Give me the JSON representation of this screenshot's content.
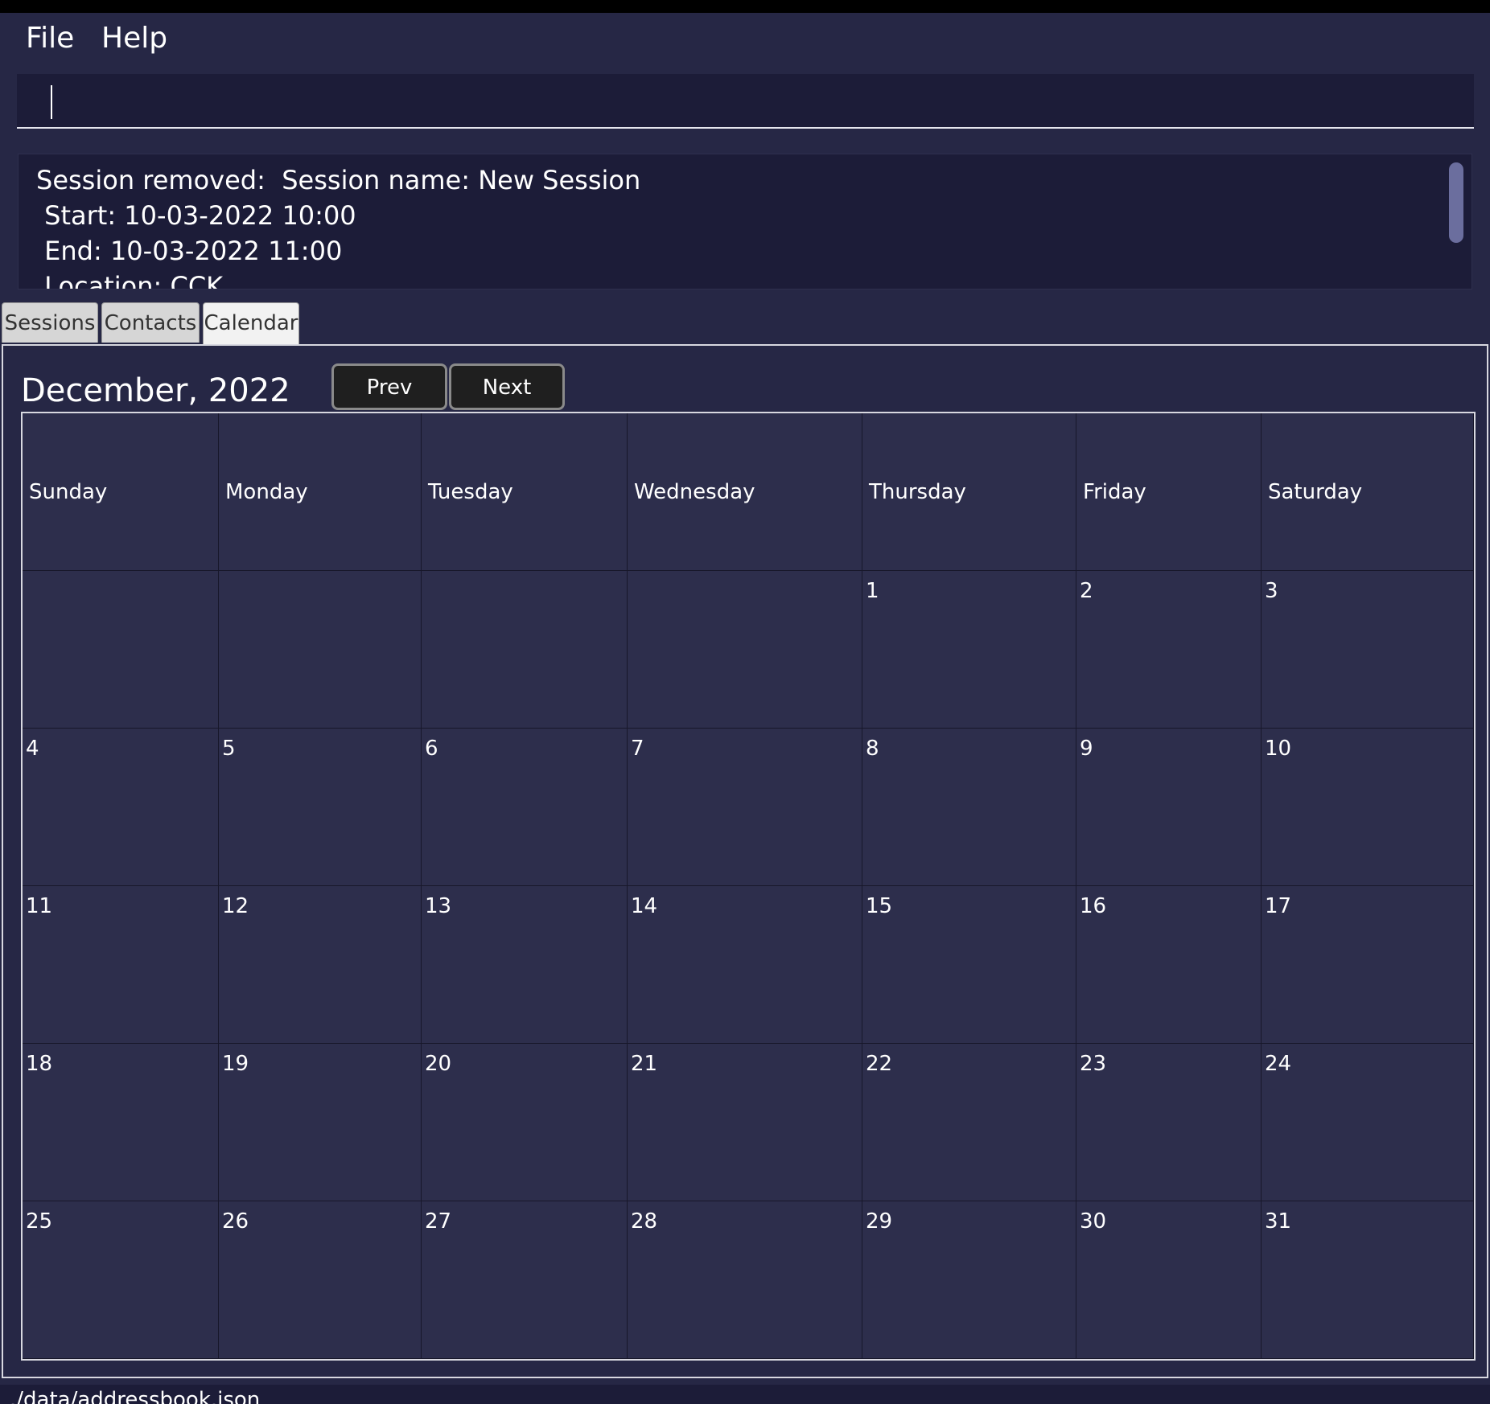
{
  "menu": {
    "file": "File",
    "help": "Help"
  },
  "command": {
    "value": "",
    "placeholder": ""
  },
  "result": {
    "text": "Session removed:  Session name: New Session\n Start: 10-03-2022 10:00\n End: 10-03-2022 11:00\n Location: CCK"
  },
  "tabs": [
    {
      "label": "Sessions"
    },
    {
      "label": "Contacts"
    },
    {
      "label": "Calendar"
    }
  ],
  "calendar": {
    "month_title": "December, 2022",
    "prev_label": "Prev",
    "next_label": "Next",
    "weekdays": [
      "Sunday",
      "Monday",
      "Tuesday",
      "Wednesday",
      "Thursday",
      "Friday",
      "Saturday"
    ],
    "weeks": [
      [
        "",
        "",
        "",
        "",
        "1",
        "2",
        "3"
      ],
      [
        "4",
        "5",
        "6",
        "7",
        "8",
        "9",
        "10"
      ],
      [
        "11",
        "12",
        "13",
        "14",
        "15",
        "16",
        "17"
      ],
      [
        "18",
        "19",
        "20",
        "21",
        "22",
        "23",
        "24"
      ],
      [
        "25",
        "26",
        "27",
        "28",
        "29",
        "30",
        "31"
      ]
    ]
  },
  "status": {
    "path": "./data/addressbook.json"
  },
  "colors": {
    "background": "#262745",
    "panel": "#1c1c38",
    "cell": "#2d2e4c"
  }
}
